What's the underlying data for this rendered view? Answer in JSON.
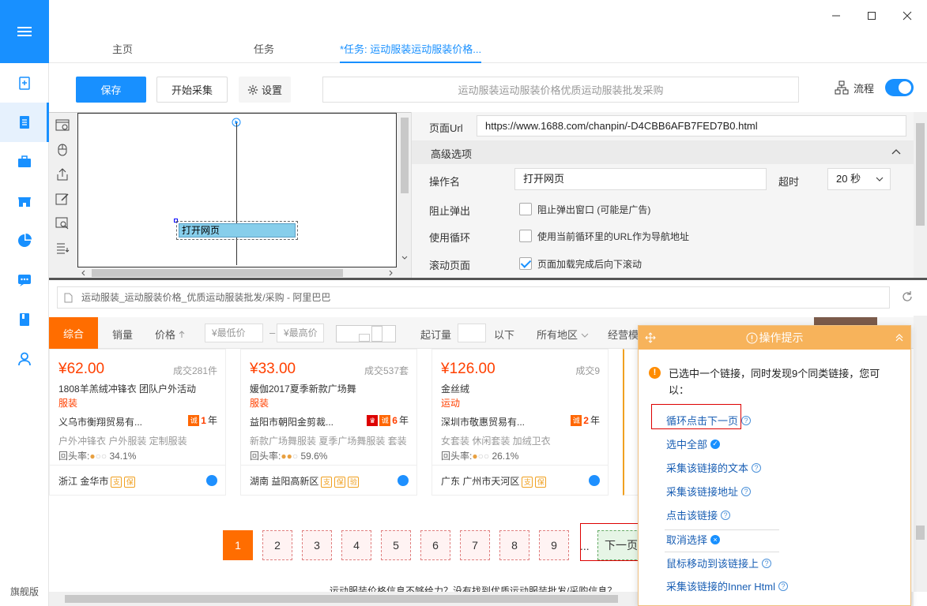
{
  "sidebar": {
    "footer": "旗舰版"
  },
  "tabs": [
    {
      "label": "主页"
    },
    {
      "label": "任务"
    },
    {
      "label": "*任务: 运动服装运动服装价格..."
    }
  ],
  "toolbar": {
    "save": "保存",
    "start": "开始采集",
    "settings": "设置",
    "task_title": "运动服装运动服装价格优质运动服装批发采购",
    "flow": "流程"
  },
  "designer": {
    "node_label": "打开网页"
  },
  "props": {
    "url_label": "页面Url",
    "url_value": "https://www.1688.com/chanpin/-D4CBB6AFB7FED7B0.html",
    "advanced": "高级选项",
    "opname_label": "操作名",
    "opname_value": "打开网页",
    "timeout_label": "超时",
    "timeout_value": "20 秒",
    "popup_label": "阻止弹出",
    "popup_text": "阻止弹出窗口 (可能是广告)",
    "loop_label": "使用循环",
    "loop_text": "使用当前循环里的URL作为导航地址",
    "scroll_label": "滚动页面",
    "scroll_text": "页面加载完成后向下滚动"
  },
  "browser": {
    "address": "运动服装_运动服装价格_优质运动服装批发/采购 - 阿里巴巴",
    "filters": {
      "comprehensive": "综合",
      "sales": "销量",
      "price": "价格",
      "min_price": "¥最低价",
      "dash": "–",
      "max_price": "¥最高价",
      "moq": "起订量",
      "below": "以下",
      "region": "所有地区",
      "business": "经营模"
    },
    "cards": [
      {
        "price": "¥62.00",
        "sold": "成交281件",
        "name": "1808羊羔绒冲锋衣 团队户外活动",
        "cat": "服装",
        "company": "义乌市衡翔贸易有...",
        "years": "1",
        "year_unit": "年",
        "tags": "户外冲锋衣 户外服装 定制服装",
        "repeat_label": "回头率:",
        "repeat": "34.1%",
        "location": "浙江 金华市"
      },
      {
        "price": "¥33.00",
        "sold": "成交537套",
        "name": "媛伽2017夏季新款广场舞",
        "cat": "服装",
        "company": "益阳市朝阳金剪裁...",
        "years": "6",
        "year_unit": "年",
        "tags": "新款广场舞服装 夏季广场舞服装 套装",
        "repeat_label": "回头率:",
        "repeat": "59.6%",
        "location": "湖南 益阳高新区"
      },
      {
        "price": "¥126.00",
        "sold": "成交9",
        "name": "金丝绒",
        "cat": "运动",
        "company": "深圳市敬惠贸易有...",
        "years": "2",
        "year_unit": "年",
        "tags": "女套装 休闲套装 加绒卫衣",
        "repeat_label": "回头率:",
        "repeat": "26.1%",
        "location": "广东 广州市天河区"
      }
    ],
    "pages": [
      "1",
      "2",
      "3",
      "4",
      "5",
      "6",
      "7",
      "8",
      "9"
    ],
    "ellipsis": "...",
    "next": "下一页",
    "bottom_text": "运动服装价格信息不够给力？没有找到优质运动服装批发/采购信息？"
  },
  "tips": {
    "title": "操作提示",
    "message": "已选中一个链接，同时发现9个同类链接，您可以：",
    "actions": [
      "循环点击下一页",
      "选中全部",
      "采集该链接的文本",
      "采集该链接地址",
      "点击该链接",
      "取消选择",
      "鼠标移动到该链接上",
      "采集该链接的Inner Html"
    ]
  },
  "colors": {
    "accent": "#1890ff",
    "orange": "#ff6d00",
    "price": "#ff4000",
    "tips_header": "#f7b35b"
  }
}
